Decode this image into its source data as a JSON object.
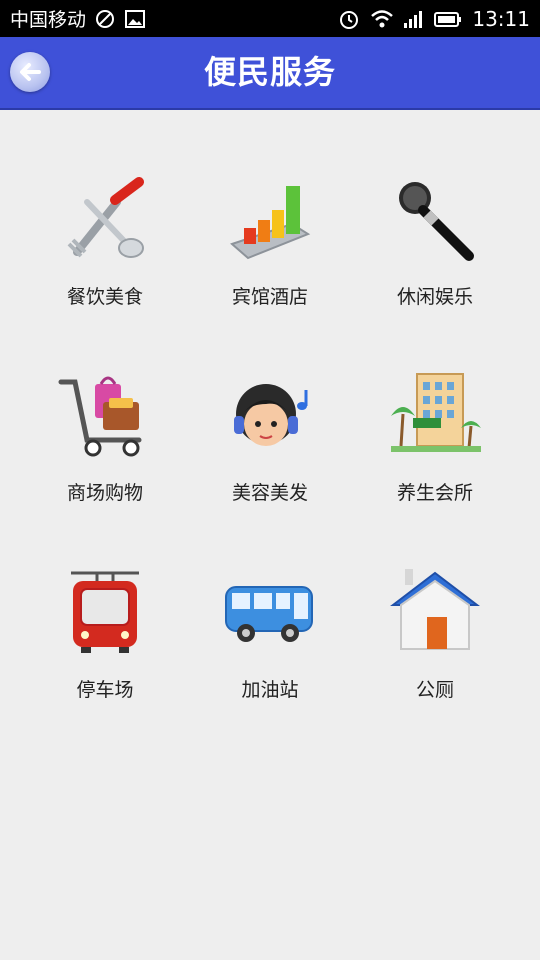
{
  "status_bar": {
    "carrier": "中国移动",
    "time": "13:11"
  },
  "header": {
    "title": "便民服务"
  },
  "services": [
    {
      "label": "餐饮美食",
      "icon": "fork-spoon-icon"
    },
    {
      "label": "宾馆酒店",
      "icon": "bar-chart-icon"
    },
    {
      "label": "休闲娱乐",
      "icon": "microphone-icon"
    },
    {
      "label": "商场购物",
      "icon": "shopping-cart-icon"
    },
    {
      "label": "美容美发",
      "icon": "headset-girl-icon"
    },
    {
      "label": "养生会所",
      "icon": "hotel-icon"
    },
    {
      "label": "停车场",
      "icon": "tram-icon"
    },
    {
      "label": "加油站",
      "icon": "bus-icon"
    },
    {
      "label": "公厕",
      "icon": "house-icon"
    }
  ],
  "colors": {
    "header_bg": "#3f51d8",
    "page_bg": "#eeeeee"
  }
}
